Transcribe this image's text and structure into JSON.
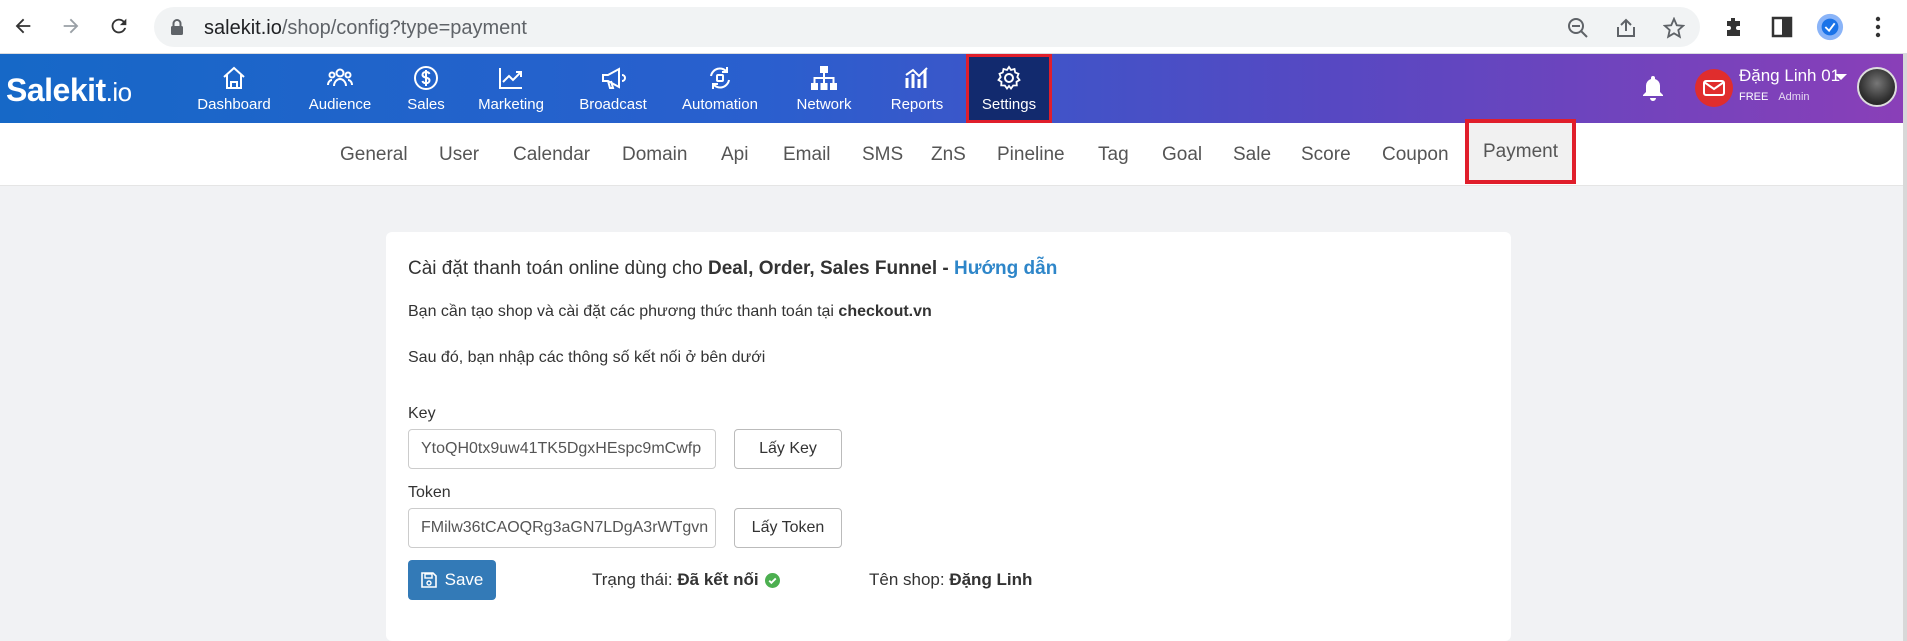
{
  "browser": {
    "url_host": "salekit.io",
    "url_path": "/shop/config?type=payment",
    "icons": [
      "back-icon",
      "forward-icon",
      "reload-icon",
      "lock-icon",
      "zoom-out-icon",
      "share-icon",
      "star-icon",
      "puzzle-icon",
      "sidebar-icon",
      "profile-icon",
      "more-icon"
    ]
  },
  "header": {
    "logo_main": "Salekit",
    "logo_suffix": ".io",
    "nav": [
      {
        "label": "Dashboard",
        "icon": "home-icon"
      },
      {
        "label": "Audience",
        "icon": "people-icon"
      },
      {
        "label": "Sales",
        "icon": "dollar-icon"
      },
      {
        "label": "Marketing",
        "icon": "chart-icon"
      },
      {
        "label": "Broadcast",
        "icon": "megaphone-icon"
      },
      {
        "label": "Automation",
        "icon": "cycle-icon"
      },
      {
        "label": "Network",
        "icon": "network-icon"
      },
      {
        "label": "Reports",
        "icon": "reports-icon"
      },
      {
        "label": "Settings",
        "icon": "gear-icon"
      }
    ],
    "active_nav": "Settings",
    "user": {
      "name": "Đặng Linh 01",
      "plan": "FREE",
      "role": "Admin"
    },
    "accent_highlight": "#e01e2b"
  },
  "subnav": {
    "items": [
      "General",
      "User",
      "Calendar",
      "Domain",
      "Api",
      "Email",
      "SMS",
      "ZnS",
      "Pineline",
      "Tag",
      "Goal",
      "Sale",
      "Score",
      "Coupon",
      "Payment"
    ],
    "active": "Payment"
  },
  "card": {
    "title_prefix": "Cài đặt thanh toán online dùng cho ",
    "title_bold": "Deal, Order, Sales Funnel - ",
    "title_link": "Hướng dẫn",
    "line1_prefix": "Bạn cần tạo shop và cài đặt các phương thức thanh toán tại ",
    "line1_bold": "checkout.vn",
    "line2": "Sau đó, bạn nhập các thông số kết nối ở bên dưới",
    "key_label": "Key",
    "key_value": "YtoQH0tx9uw41TK5DgxHEspc9mCwfp",
    "key_button": "Lấy Key",
    "token_label": "Token",
    "token_value": "FMilw36tCAOQRg3aGN7LDgA3rWTgvn",
    "token_button": "Lấy Token",
    "save_label": "Save",
    "status_label": "Trạng thái: ",
    "status_value": "Đã kết nối",
    "shop_label": "Tên shop: ",
    "shop_value": "Đặng Linh"
  }
}
